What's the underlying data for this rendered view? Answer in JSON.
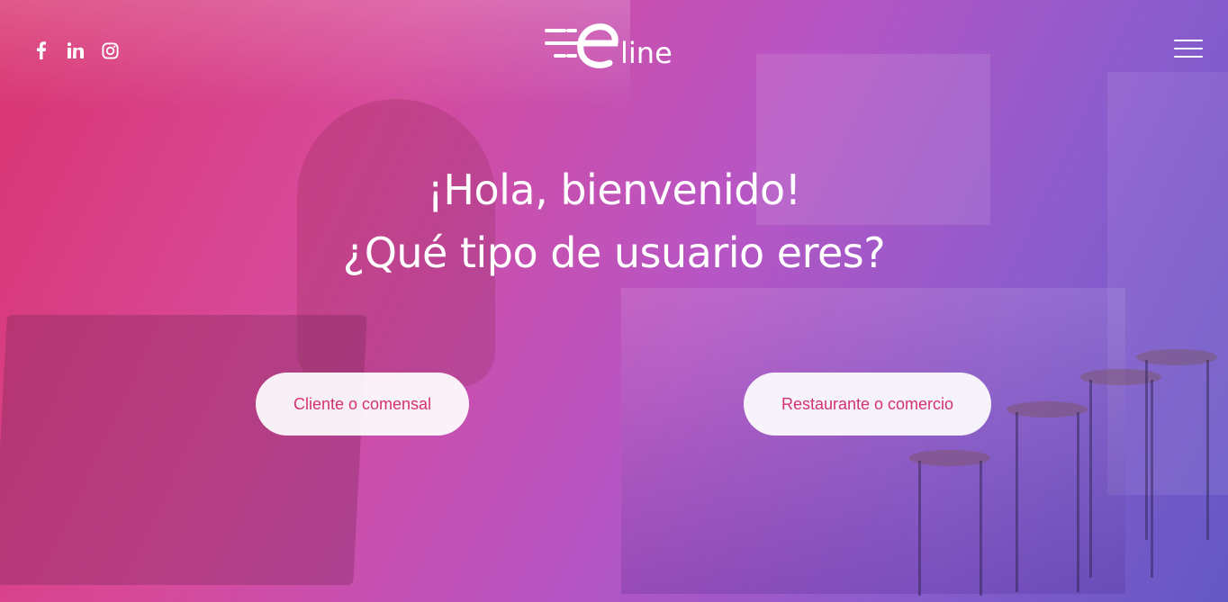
{
  "brand": {
    "logo_text": "line",
    "accent": "#d3336f"
  },
  "header": {
    "social": [
      {
        "icon": "facebook-icon"
      },
      {
        "icon": "linkedin-icon"
      },
      {
        "icon": "instagram-icon"
      }
    ],
    "menu_icon": "hamburger-menu-icon"
  },
  "hero": {
    "greeting": "¡Hola, bienvenido!",
    "question": "¿Qué tipo de usuario eres?",
    "buttons": {
      "client": "Cliente o comensal",
      "restaurant": "Restaurante o comercio"
    }
  },
  "colors": {
    "gradient_start": "#d9346f",
    "gradient_mid": "#b855c4",
    "gradient_end": "#6458c4"
  }
}
